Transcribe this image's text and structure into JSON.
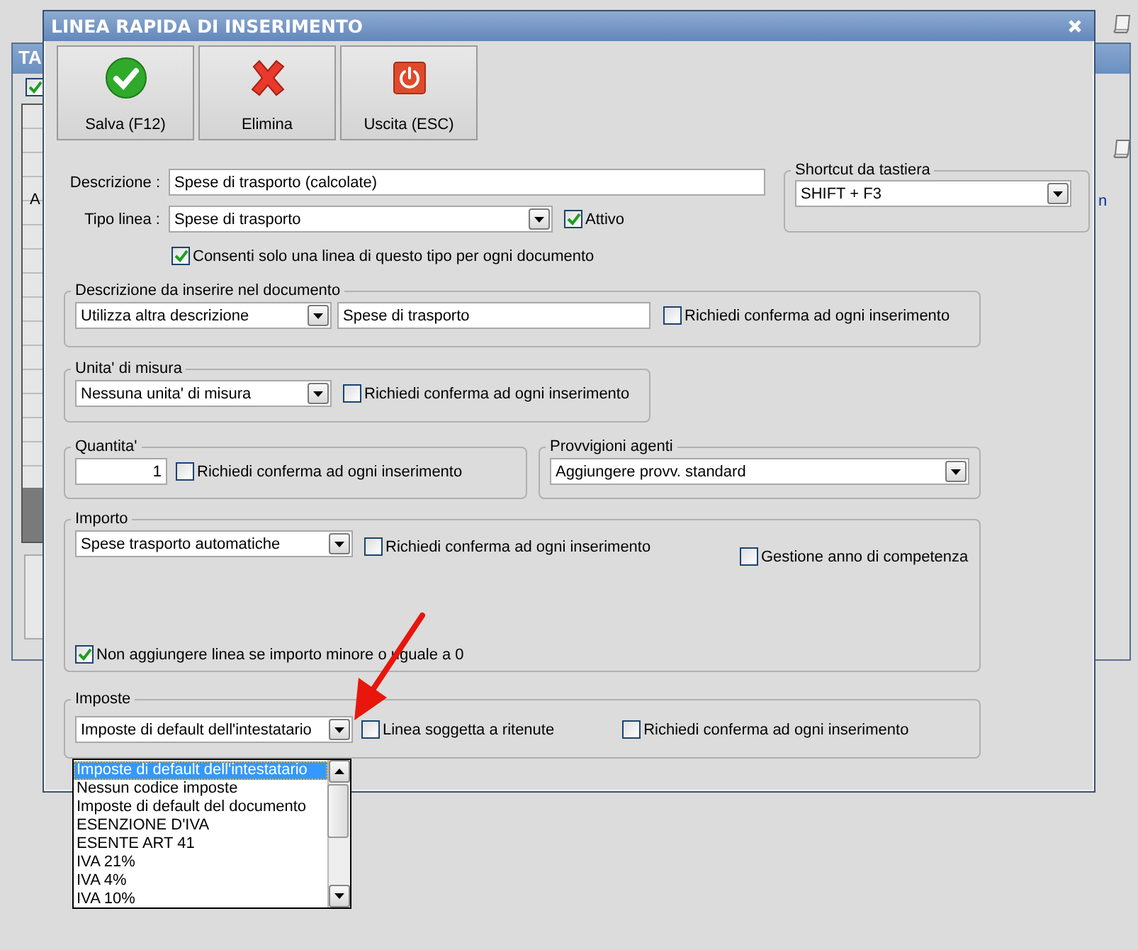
{
  "background_window": {
    "title": "TA",
    "checkbox": {
      "checked": true
    },
    "left_text": "A",
    "side_text": "n"
  },
  "dialog": {
    "title": "LINEA RAPIDA DI INSERIMENTO",
    "toolbar": [
      {
        "kind": "save",
        "label": "Salva (F12)"
      },
      {
        "kind": "delete",
        "label": "Elimina"
      },
      {
        "kind": "exit",
        "label": "Uscita (ESC)"
      }
    ],
    "descrizione": {
      "label": "Descrizione :",
      "value": "Spese di trasporto (calcolate)"
    },
    "tipo_linea": {
      "label": "Tipo linea :",
      "value": "Spese di trasporto"
    },
    "attivo": {
      "label": "Attivo",
      "checked": true
    },
    "consenti": {
      "label": "Consenti solo una linea di questo tipo per ogni documento",
      "checked": true
    },
    "shortcut": {
      "title": "Shortcut da tastiera",
      "value": "SHIFT + F3"
    },
    "descrizione_documento": {
      "title": "Descrizione da inserire nel documento",
      "mode": "Utilizza altra descrizione",
      "text": "Spese di trasporto",
      "confirm": {
        "label": "Richiedi conferma ad ogni inserimento",
        "checked": false
      }
    },
    "unita_misura": {
      "title": "Unita' di misura",
      "value": "Nessuna unita' di misura",
      "confirm": {
        "label": "Richiedi conferma ad ogni inserimento",
        "checked": false
      }
    },
    "quantita": {
      "title": "Quantita'",
      "value": "1",
      "confirm": {
        "label": "Richiedi conferma ad ogni inserimento",
        "checked": false
      }
    },
    "provvigioni": {
      "title": "Provvigioni agenti",
      "value": "Aggiungere provv. standard"
    },
    "importo": {
      "title": "Importo",
      "value": "Spese trasporto automatiche",
      "confirm": {
        "label": "Richiedi conferma ad ogni inserimento",
        "checked": false
      },
      "anno_competenza": {
        "label": "Gestione anno di competenza",
        "checked": false
      },
      "non_aggiungere": {
        "label": "Non aggiungere linea se importo minore o uguale a 0",
        "checked": true
      }
    },
    "imposte": {
      "title": "Imposte",
      "value": "Imposte di default dell'intestatario",
      "expanded": true,
      "ritenute": {
        "label": "Linea soggetta a ritenute",
        "checked": false
      },
      "confirm": {
        "label": "Richiedi conferma ad ogni inserimento",
        "checked": false
      },
      "options": [
        {
          "label": "Imposte di default dell'intestatario",
          "selected": true
        },
        {
          "label": "Nessun codice imposte",
          "selected": false
        },
        {
          "label": "Imposte di default del documento",
          "selected": false
        },
        {
          "label": "ESENZIONE D'IVA",
          "selected": false
        },
        {
          "label": "ESENTE ART 41",
          "selected": false
        },
        {
          "label": "IVA 21%",
          "selected": false
        },
        {
          "label": "IVA 4%",
          "selected": false
        },
        {
          "label": "IVA 10%",
          "selected": false
        }
      ]
    }
  }
}
